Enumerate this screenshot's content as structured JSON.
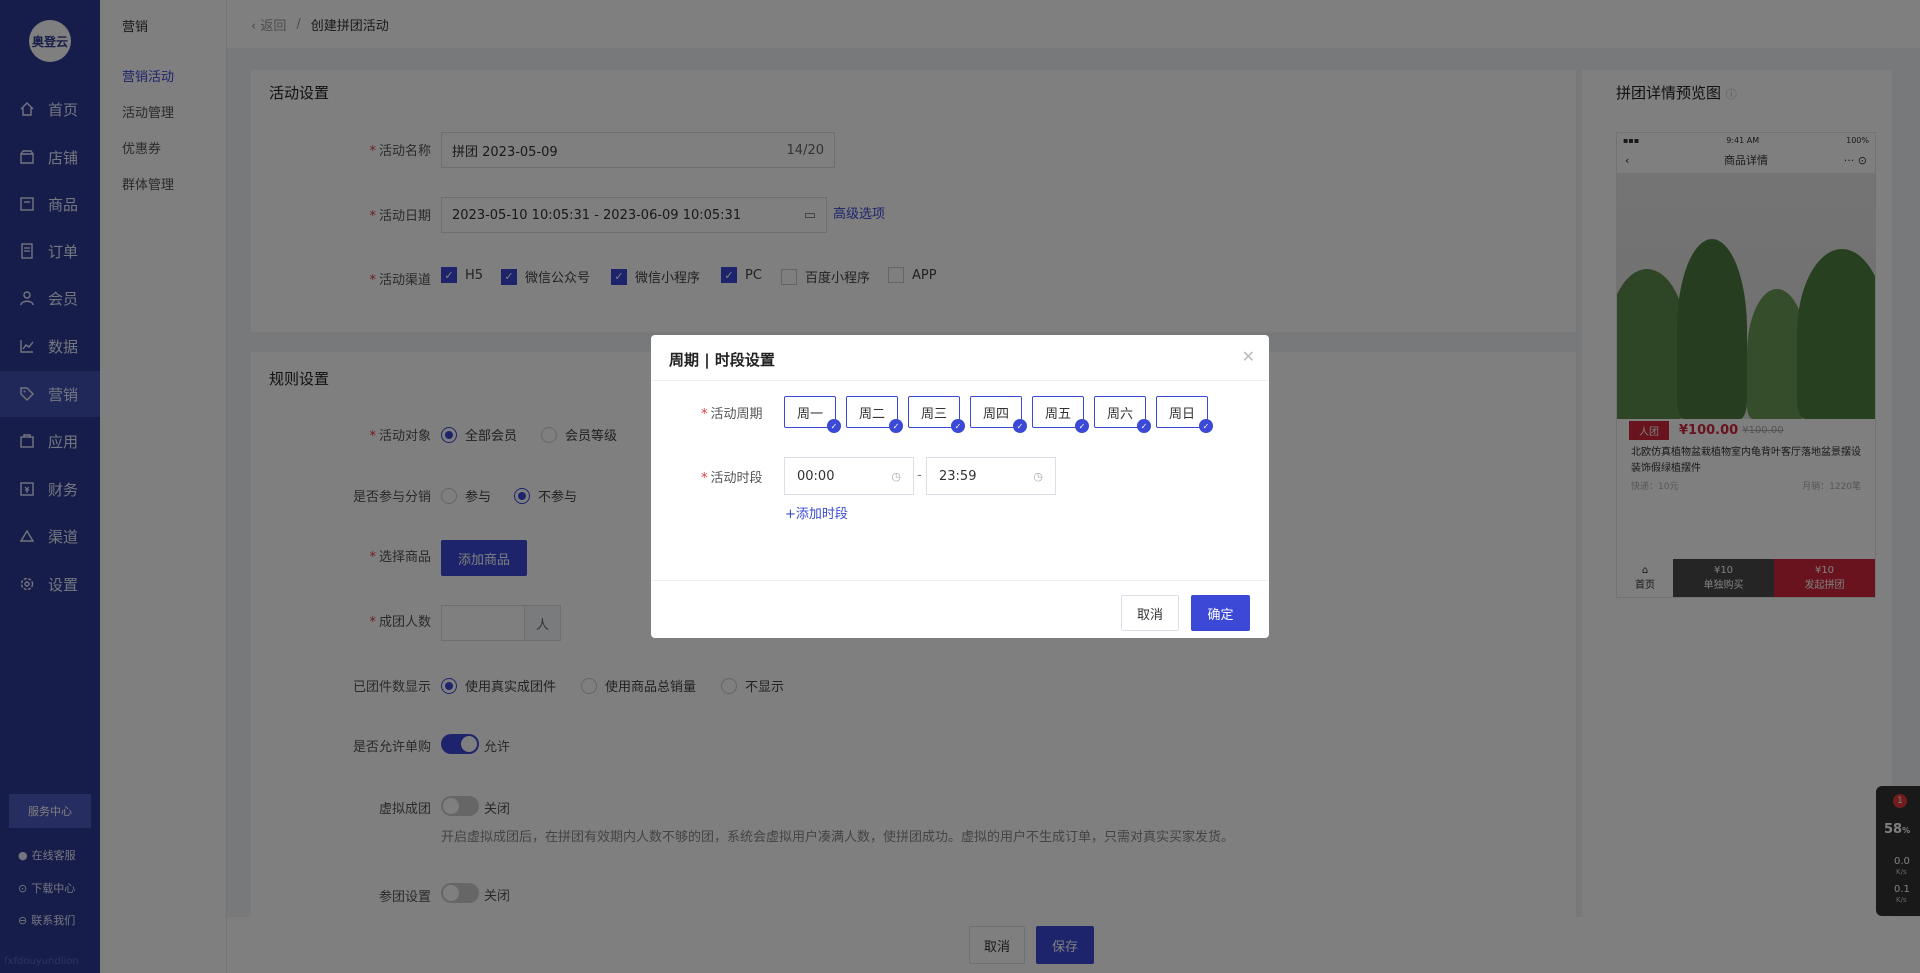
{
  "nav": {
    "logo": "奥登云",
    "items": [
      {
        "label": "首页",
        "icon": "home-icon"
      },
      {
        "label": "店铺",
        "icon": "store-icon"
      },
      {
        "label": "商品",
        "icon": "product-icon"
      },
      {
        "label": "订单",
        "icon": "order-icon"
      },
      {
        "label": "会员",
        "icon": "member-icon"
      },
      {
        "label": "数据",
        "icon": "chart-icon"
      },
      {
        "label": "营销",
        "icon": "tag-icon"
      },
      {
        "label": "应用",
        "icon": "app-icon"
      },
      {
        "label": "财务",
        "icon": "finance-icon"
      },
      {
        "label": "渠道",
        "icon": "channel-icon"
      },
      {
        "label": "设置",
        "icon": "gear-icon"
      }
    ],
    "service_center": "服务中心",
    "online_service": "在线客服",
    "download_center": "下载中心",
    "contact_us": "联系我们",
    "footer": "fxfdouyundlion"
  },
  "subnav": {
    "title": "营销",
    "items": [
      "营销活动",
      "活动管理",
      "优惠券",
      "群体管理"
    ]
  },
  "breadcrumb": {
    "back": "返回",
    "sep": "/",
    "current": "创建拼团活动"
  },
  "activity": {
    "section_title": "活动设置",
    "name_label": "活动名称",
    "name_value": "拼团  2023-05-09",
    "name_count": "14/20",
    "date_label": "活动日期",
    "date_value": "2023-05-10 10:05:31 - 2023-06-09 10:05:31",
    "advanced": "高级选项",
    "channel_label": "活动渠道",
    "channels": [
      {
        "label": "H5",
        "checked": true
      },
      {
        "label": "微信公众号",
        "checked": true
      },
      {
        "label": "微信小程序",
        "checked": true
      },
      {
        "label": "PC",
        "checked": true
      },
      {
        "label": "百度小程序",
        "checked": false
      },
      {
        "label": "APP",
        "checked": false
      }
    ]
  },
  "rules": {
    "section_title": "规则设置",
    "target_label": "活动对象",
    "target_options": [
      "全部会员",
      "会员等级"
    ],
    "distribution_label": "是否参与分销",
    "distribution_options": [
      "参与",
      "不参与"
    ],
    "goods_label": "选择商品",
    "add_goods": "添加商品",
    "group_size_label": "成团人数",
    "group_size_unit": "人",
    "group_count_label": "已团件数显示",
    "group_count_options": [
      "使用真实成团件",
      "使用商品总销量",
      "不显示"
    ],
    "single_buy_label": "是否允许单购",
    "single_buy_value": "允许",
    "virtual_label": "虚拟成团",
    "virtual_value": "关闭",
    "virtual_hint": "开启虚拟成团后，在拼团有效期内人数不够的团，系统会虚拟用户凑满人数，使拼团成功。虚拟的用户不生成订单，只需对真实买家发货。",
    "join_label": "参团设置",
    "join_value": "关闭"
  },
  "preview": {
    "title": "拼团详情预览图",
    "status_time": "9:41 AM",
    "status_battery": "100%",
    "header": "商品详情",
    "tag": "人团",
    "price": "¥100.00",
    "old_price": "¥100.00",
    "product_title": "北欧仿真植物盆栽植物室内龟背叶客厅落地盆景摆设装饰假绿植摆件",
    "shipping": "快递：10元",
    "sales": "月销：1220笔",
    "foot_home": "首页",
    "foot_single_price": "¥10",
    "foot_single": "单独购买",
    "foot_group_price": "¥10",
    "foot_group": "发起拼团"
  },
  "dialog": {
    "title": "周期 | 时段设置",
    "period_label": "活动周期",
    "days": [
      "周一",
      "周二",
      "周三",
      "周四",
      "周五",
      "周六",
      "周日"
    ],
    "time_label": "活动时段",
    "start": "00:00",
    "dash": "-",
    "end": "23:59",
    "add_time": "+添加时段",
    "cancel": "取消",
    "confirm": "确定"
  },
  "bottom": {
    "cancel": "取消",
    "save": "保存"
  },
  "widget": {
    "badge": "1",
    "percent": "58",
    "unit": "%",
    "up": "0.0",
    "down": "0.1",
    "rate": "K/s"
  },
  "colors": {
    "primary": "#3b49d6",
    "sidebar": "#2d3a94",
    "danger": "#d0263c"
  }
}
